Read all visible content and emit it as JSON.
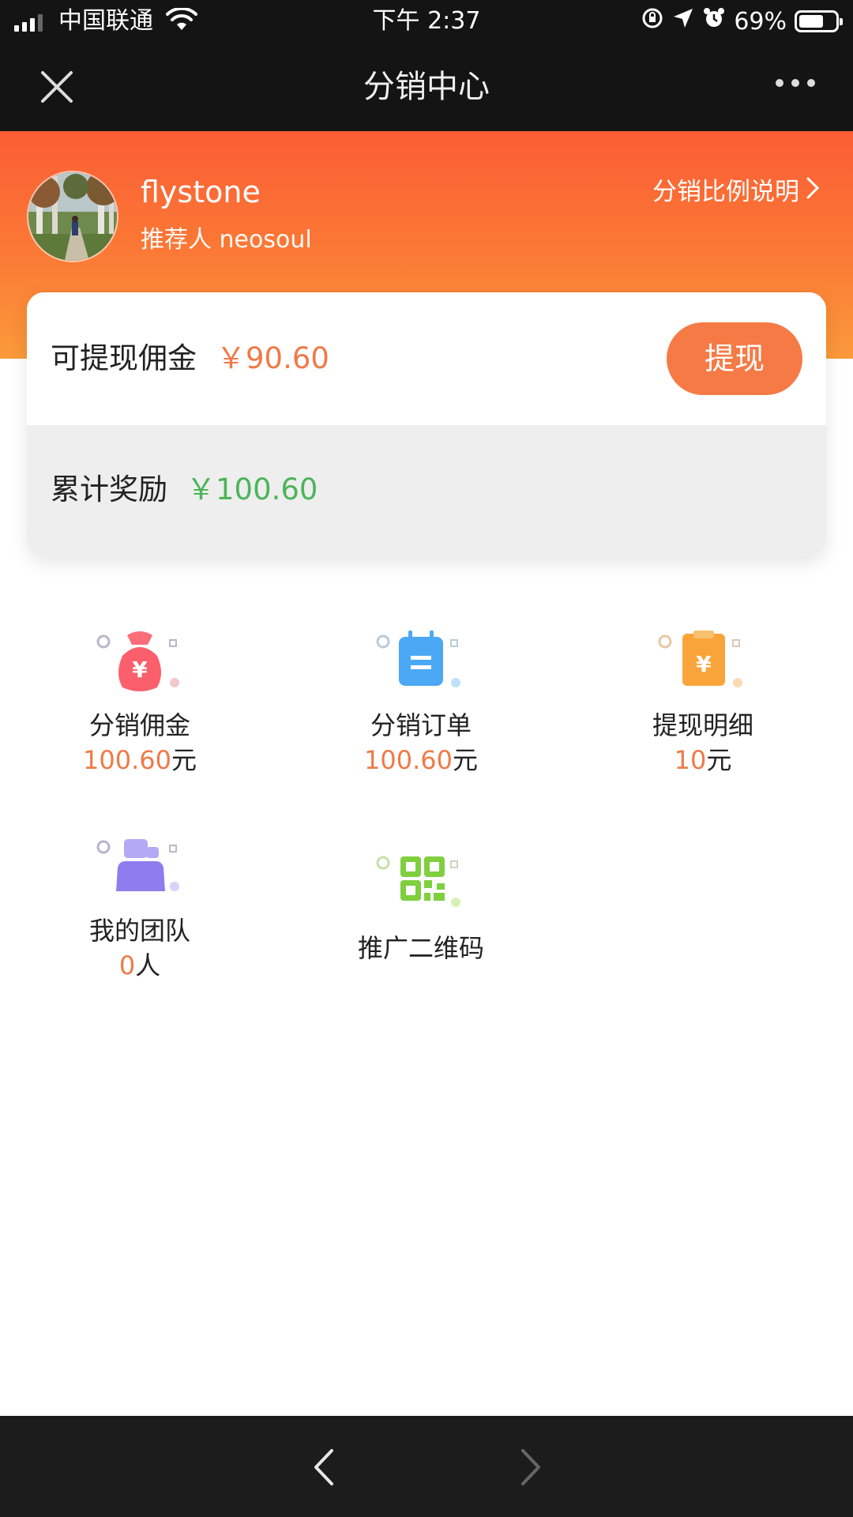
{
  "status_bar": {
    "carrier": "中国联通",
    "time": "下午 2:37",
    "battery": "69%",
    "battery_level": 0.69,
    "icons": [
      "signal-icon",
      "wifi-icon",
      "rotation-lock-icon",
      "location-icon",
      "alarm-icon",
      "battery-icon"
    ]
  },
  "navbar": {
    "title": "分销中心",
    "icons": [
      "close-icon",
      "more-icon"
    ]
  },
  "profile": {
    "username": "flystone",
    "referrer": "推荐人 neosoul",
    "ratio_link": "分销比例说明"
  },
  "balance": {
    "withdrawable_label": "可提现佣金",
    "withdrawable_value": "￥90.60",
    "withdraw_button": "提现",
    "total_label": "累计奖励",
    "total_value": "￥100.60",
    "colors": {
      "withdrawable": "#ef7a47",
      "total": "#4cb45a",
      "button": "#f67a45"
    }
  },
  "grid": [
    {
      "label": "分销佣金",
      "value": "100.60",
      "unit": "元",
      "icon": "money-bag-icon"
    },
    {
      "label": "分销订单",
      "value": "100.60",
      "unit": "元",
      "icon": "order-calendar-icon"
    },
    {
      "label": "提现明细",
      "value": "10",
      "unit": "元",
      "icon": "withdraw-detail-icon"
    },
    {
      "label": "我的团队",
      "value": "0",
      "unit": "人",
      "icon": "team-icon"
    },
    {
      "label": "推广二维码",
      "icon": "qrcode-icon"
    }
  ],
  "bottom_bar": {
    "icons": [
      "back-arrow-icon",
      "forward-arrow-icon"
    ]
  },
  "colors": {
    "header_gradient_top": "#fb5d35",
    "header_gradient_bottom": "#fb9a3b",
    "accent_number": "#ef7a47"
  }
}
